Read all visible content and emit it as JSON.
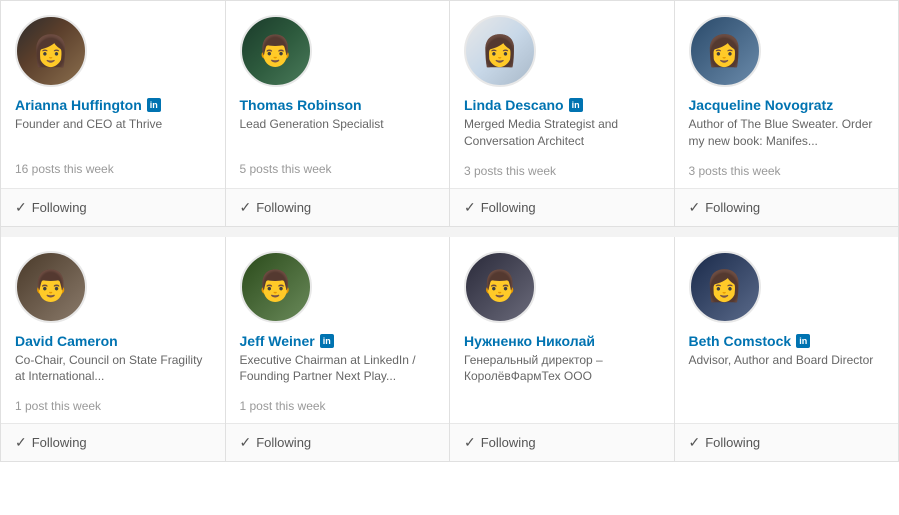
{
  "people": [
    {
      "id": "arianna",
      "name": "Arianna Huffington",
      "has_linkedin": true,
      "title": "Founder and CEO at Thrive",
      "posts": "16 posts this week",
      "avatar_class": "avatar-arianna",
      "avatar_emoji": "👩"
    },
    {
      "id": "thomas",
      "name": "Thomas Robinson",
      "has_linkedin": false,
      "title": "Lead Generation Specialist",
      "posts": "5 posts this week",
      "avatar_class": "avatar-thomas",
      "avatar_emoji": "👨"
    },
    {
      "id": "linda",
      "name": "Linda Descano",
      "has_linkedin": true,
      "title": "Merged Media Strategist and Conversation Architect",
      "posts": "3 posts this week",
      "avatar_class": "avatar-linda",
      "avatar_emoji": "👩"
    },
    {
      "id": "jacqueline",
      "name": "Jacqueline Novogratz",
      "has_linkedin": false,
      "title": "Author of The Blue Sweater. Order my new book: Manifes...",
      "posts": "3 posts this week",
      "avatar_class": "avatar-jacqueline",
      "avatar_emoji": "👩"
    },
    {
      "id": "david",
      "name": "David Cameron",
      "has_linkedin": false,
      "title": "Co-Chair, Council on State Fragility at International...",
      "posts": "1 post this week",
      "avatar_class": "avatar-david",
      "avatar_emoji": "👨"
    },
    {
      "id": "jeff",
      "name": "Jeff Weiner",
      "has_linkedin": true,
      "title": "Executive Chairman at LinkedIn / Founding Partner Next Play...",
      "posts": "1 post this week",
      "avatar_class": "avatar-jeff",
      "avatar_emoji": "👨"
    },
    {
      "id": "nikolay",
      "name": "Нужненко Николай",
      "has_linkedin": false,
      "title": "Генеральный директор – КоролёвФармТех ООО",
      "posts": "",
      "avatar_class": "avatar-nikolay",
      "avatar_emoji": "👨"
    },
    {
      "id": "beth",
      "name": "Beth Comstock",
      "has_linkedin": true,
      "title": "Advisor, Author and Board Director",
      "posts": "",
      "avatar_class": "avatar-beth",
      "avatar_emoji": "👩"
    }
  ],
  "following_label": "Following",
  "linkedin_label": "in"
}
